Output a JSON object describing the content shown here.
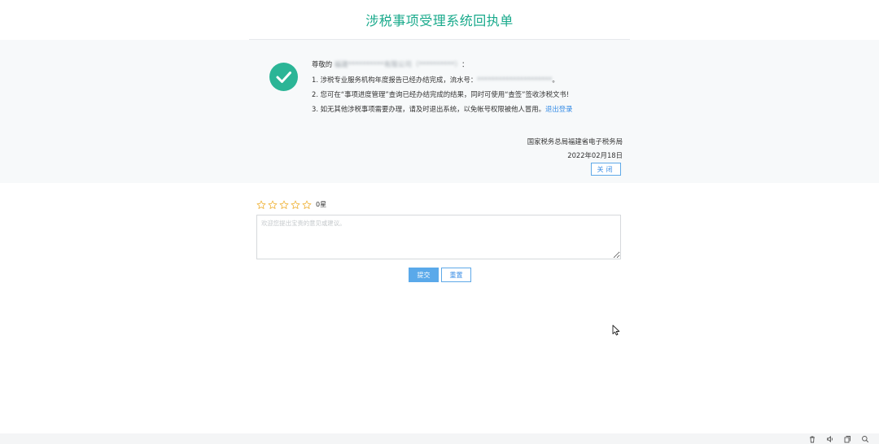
{
  "page": {
    "title": "涉税事项受理系统回执单"
  },
  "receipt": {
    "greeting_prefix": "尊敬的",
    "taxpayer_masked": "福建**********有限公司（**********）",
    "greeting_suffix": "：",
    "line1_prefix": "1. 涉税专业服务机构年度报告已经办结完成，流水号：",
    "serial_masked": "*********************",
    "line1_suffix": "。",
    "line2": "2. 您可在“事项进度管理”查询已经办结完成的结果，同时可使用“查签”签收涉税文书!",
    "line3": "3. 如无其他涉税事项需要办理，请及时退出系统，以免帐号权限被他人冒用。",
    "logout_link": "退出登录",
    "issuer": "国家税务总局福建省电子税务局",
    "date": "2022年02月18日",
    "close_button": "关闭"
  },
  "rating": {
    "stars_total": 5,
    "stars_filled": 0,
    "count_label": "0星",
    "star_color": "#f0b43c"
  },
  "feedback": {
    "placeholder": "欢迎您提出宝贵的意见或建议。",
    "value": "",
    "submit_button": "提交",
    "reset_button": "重置"
  },
  "colors": {
    "accent": "#1aaa8c",
    "check": "#2bb596",
    "link": "#3a8ee6",
    "primary_button": "#5aa9ea"
  },
  "tray": {
    "icons": [
      "trash-icon",
      "speaker-icon",
      "copy-icon",
      "search-icon"
    ]
  }
}
